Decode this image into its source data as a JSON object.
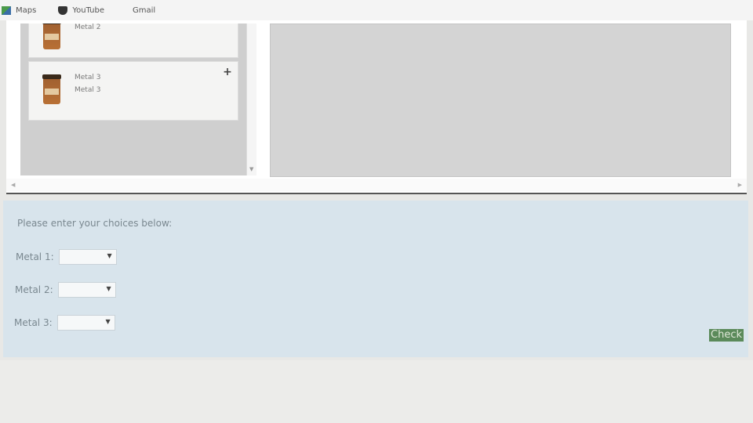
{
  "bookmarks": [
    {
      "label": "Maps",
      "icon": "maps-icon"
    },
    {
      "label": "YouTube",
      "icon": "youtube-icon"
    },
    {
      "label": "Gmail",
      "icon": "gmail-icon"
    }
  ],
  "cards": [
    {
      "lines": [
        "Metal 2"
      ]
    },
    {
      "lines": [
        "Metal 3",
        "Metal 3"
      ],
      "add_label": "+"
    }
  ],
  "choices": {
    "prompt": "Please enter your choices below:",
    "rows": [
      {
        "label": "Metal 1:",
        "value": ""
      },
      {
        "label": "Metal 2:",
        "value": ""
      },
      {
        "label": "Metal 3:",
        "value": ""
      }
    ],
    "check_label": "Check"
  }
}
